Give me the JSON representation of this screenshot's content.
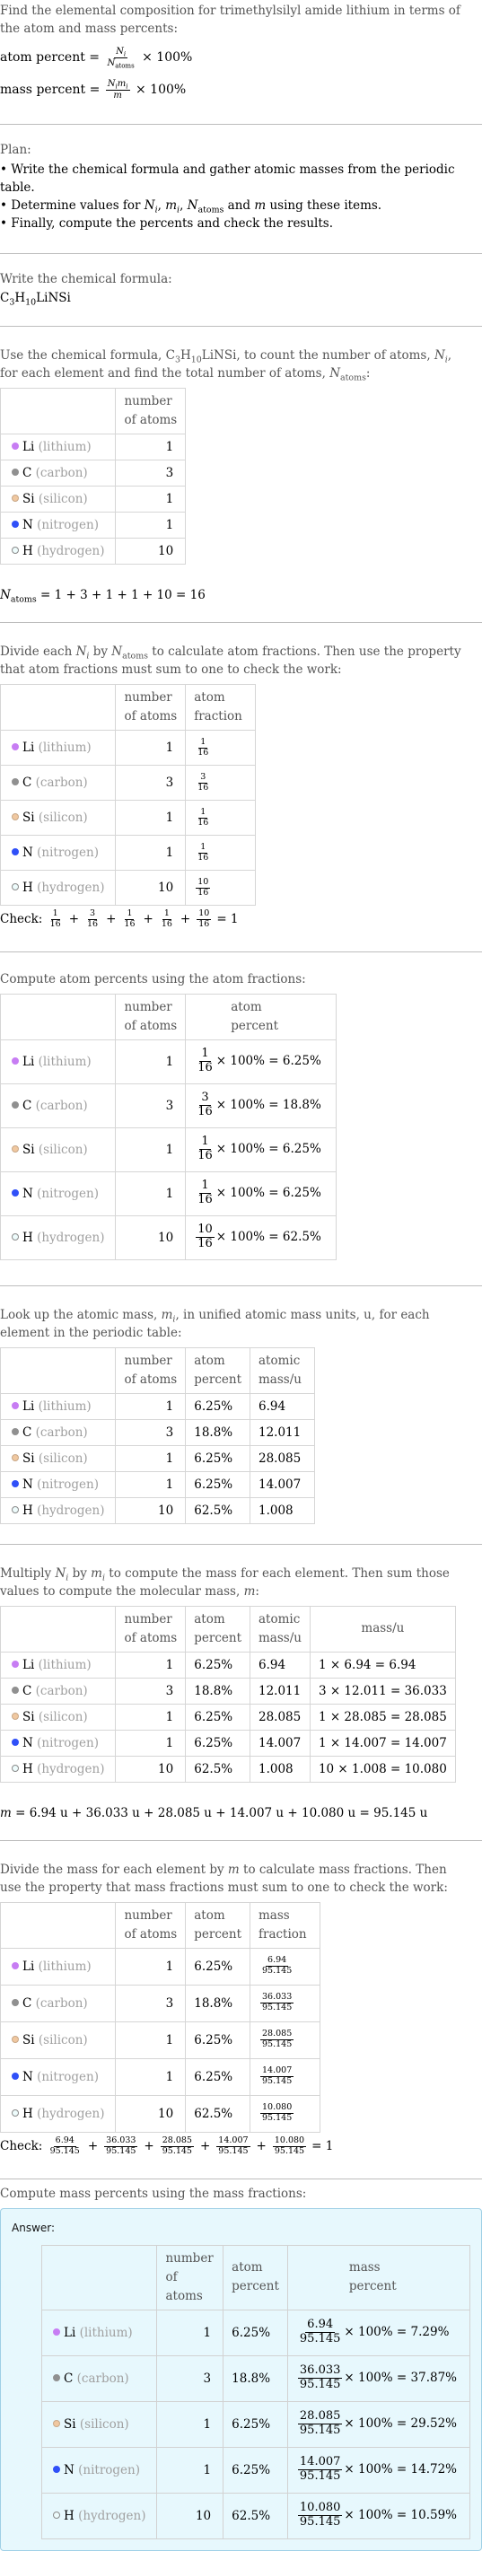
{
  "intro": {
    "text": "Find the elemental composition for trimethylsilyl amide lithium in terms of the atom and mass percents:",
    "atom_percent_label": "atom percent",
    "mass_percent_label": "mass percent",
    "eq": "=",
    "times100": "× 100%",
    "Ni": "N",
    "i": "i",
    "Natoms_N": "N",
    "atoms_sub": "atoms",
    "mi": "m",
    "m": "m"
  },
  "plan": {
    "title": "Plan:",
    "items": [
      "• Write the chemical formula and gather atomic masses from the periodic table.",
      "• Determine values for N_i, m_i, N_atoms and m using these items.",
      "• Finally, compute the percents and check the results."
    ],
    "item2_parts": {
      "prefix": "• Determine values for ",
      "N": "N",
      "i": "i",
      "comma": ", ",
      "m": "m",
      "Natoms_sub": "atoms",
      "and": " and ",
      "suffix": " using these items."
    }
  },
  "formula_section": {
    "intro": "Write the chemical formula:",
    "formula": {
      "C": "C",
      "C_sub": "3",
      "H": "H",
      "H_sub": "10",
      "rest": "LiNSi"
    }
  },
  "count_section": {
    "intro_parts": [
      "Use the chemical formula, ",
      ", to count the number of atoms, ",
      ", for each element and find the total number of atoms, ",
      ":"
    ],
    "natoms_equation": "= 1 + 3 + 1 + 1 + 10 = 16"
  },
  "headers": {
    "number_of_atoms": [
      "number",
      "of atoms"
    ],
    "atom_fraction": [
      "atom",
      "fraction"
    ],
    "atom_percent": [
      "atom",
      "percent"
    ],
    "atomic_mass": [
      "atomic",
      "mass/u"
    ],
    "mass": "mass/u",
    "mass_fraction": [
      "mass",
      "fraction"
    ],
    "mass_percent": [
      "mass",
      "percent"
    ]
  },
  "elements": [
    {
      "symbol": "Li",
      "name": "(lithium)",
      "color": "#c77df3",
      "border": "#c77df3",
      "count": "1",
      "frac_num": "1",
      "frac_den": "16",
      "atom_percent": "6.25%",
      "atomic_mass": "6.94",
      "mass_calc": "1 × 6.94 = 6.94",
      "mass": "6.94",
      "mass_percent": "7.29%"
    },
    {
      "symbol": "C",
      "name": "(carbon)",
      "color": "#909090",
      "border": "#909090",
      "count": "3",
      "frac_num": "3",
      "frac_den": "16",
      "atom_percent": "18.8%",
      "atomic_mass": "12.011",
      "mass_calc": "3 × 12.011 = 36.033",
      "mass": "36.033",
      "mass_percent": "37.87%"
    },
    {
      "symbol": "Si",
      "name": "(silicon)",
      "color": "#f0c8a0",
      "border": "#c8a888",
      "count": "1",
      "frac_num": "1",
      "frac_den": "16",
      "atom_percent": "6.25%",
      "atomic_mass": "28.085",
      "mass_calc": "1 × 28.085 = 28.085",
      "mass": "28.085",
      "mass_percent": "29.52%"
    },
    {
      "symbol": "N",
      "name": "(nitrogen)",
      "color": "#3050f8",
      "border": "#3050f8",
      "count": "1",
      "frac_num": "1",
      "frac_den": "16",
      "atom_percent": "6.25%",
      "atomic_mass": "14.007",
      "mass_calc": "1 × 14.007 = 14.007",
      "mass": "14.007",
      "mass_percent": "14.72%"
    },
    {
      "symbol": "H",
      "name": "(hydrogen)",
      "color": "#eefcfc",
      "border": "#8a8a8a",
      "count": "10",
      "frac_num": "10",
      "frac_den": "16",
      "atom_percent": "62.5%",
      "atomic_mass": "1.008",
      "mass_calc": "10 × 1.008 = 10.080",
      "mass": "10.080",
      "mass_percent": "10.59%"
    }
  ],
  "fraction_section": {
    "intro_parts": [
      "Divide each ",
      " by ",
      " to calculate atom fractions. Then use the property that atom fractions must sum to one to check the work:"
    ],
    "check_label": "Check:",
    "plus": "+",
    "equals_one": "= 1"
  },
  "atom_percent_section": {
    "intro": "Compute atom percents using the atom fractions:",
    "times100_eq": "× 100% ="
  },
  "atomic_mass_section": {
    "intro_parts": [
      "Look up the atomic mass, ",
      ", in unified atomic mass units, u, for each element in the periodic table:"
    ]
  },
  "mass_section": {
    "intro_parts": [
      "Multiply ",
      " by ",
      " to compute the mass for each element. Then sum those values to compute the molecular mass, ",
      ":"
    ],
    "m_equation": "= 6.94 u + 36.033 u + 28.085 u + 14.007 u + 10.080 u = 95.145 u"
  },
  "mass_fraction_section": {
    "intro_parts": [
      "Divide the mass for each element by ",
      " to calculate mass fractions. Then use the property that mass fractions must sum to one to check the work:"
    ],
    "denominator": "95.145",
    "check_label": "Check:",
    "plus": "+",
    "equals_one": "= 1"
  },
  "mass_percent_section": {
    "intro": "Compute mass percents using the mass fractions:",
    "answer_label": "Answer:",
    "times100_eq": "× 100% ="
  }
}
